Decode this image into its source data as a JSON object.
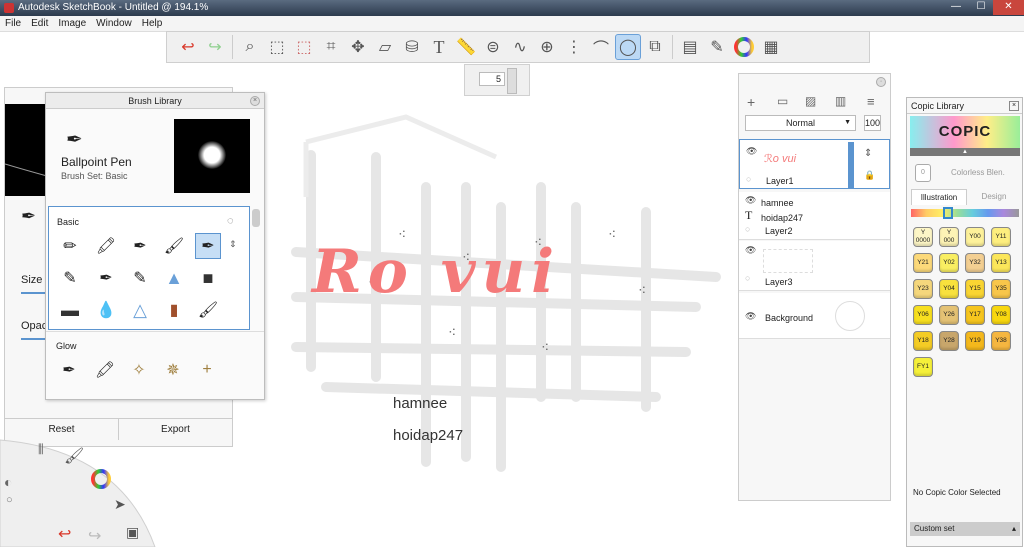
{
  "window": {
    "title": "Autodesk SketchBook - Untitled @ 194.1%",
    "minimize": "—",
    "maximize": "☐",
    "close": "✕"
  },
  "menu": [
    "File",
    "Edit",
    "Image",
    "Window",
    "Help"
  ],
  "toolbar": {
    "icons": [
      "undo-icon",
      "redo-icon",
      "zoom-icon",
      "select-rect-icon",
      "select-lasso-icon",
      "crop-icon",
      "transform-icon",
      "distort-icon",
      "cylinder-icon",
      "text-icon",
      "ruler-icon",
      "ellipse-guide-icon",
      "french-curve-icon",
      "perspective-icon",
      "symmetry-icon",
      "stroke-icon",
      "ellipse-icon",
      "shapes-icon",
      "copic-icon",
      "brushes-icon",
      "color-wheel-icon",
      "palette-icon"
    ],
    "brush_size": "5"
  },
  "left_panel": {
    "size_label": "Size",
    "opacity_label": "Opacit",
    "reset_label": "Reset",
    "export_label": "Export"
  },
  "brush_library": {
    "title": "Brush Library",
    "brush_name": "Ballpoint Pen",
    "brush_set": "Brush Set: Basic",
    "basic_label": "Basic",
    "glow_label": "Glow"
  },
  "canvas": {
    "lettering": "Ro vui",
    "text1": "hamnee",
    "text2": "hoidap247"
  },
  "layers": {
    "blend_mode": "Normal",
    "opacity": "100",
    "rows": [
      {
        "name": "Layer1"
      },
      {
        "name": "hamnee",
        "sub1": "hoidap247",
        "sub2": "Layer2"
      },
      {
        "name": "Layer3"
      },
      {
        "name": "Background"
      }
    ]
  },
  "copic": {
    "title": "Copic Library",
    "logo": "COPIC",
    "colorless": "Colorless Blen.",
    "colorless_code": "0",
    "tab_illustration": "Illustration",
    "tab_design": "Design",
    "swatches": [
      {
        "code": "Y\n0000",
        "color": "#fdf6c6"
      },
      {
        "code": "Y\n000",
        "color": "#fdf3b5"
      },
      {
        "code": "Y00",
        "color": "#fdf19a"
      },
      {
        "code": "Y11",
        "color": "#fdee7e"
      },
      {
        "code": "Y21",
        "color": "#fcd97a"
      },
      {
        "code": "Y02",
        "color": "#f9ee62"
      },
      {
        "code": "Y32",
        "color": "#f3cf92"
      },
      {
        "code": "Y13",
        "color": "#fbe65a"
      },
      {
        "code": "Y23",
        "color": "#f5d77c"
      },
      {
        "code": "Y04",
        "color": "#f8e13d"
      },
      {
        "code": "Y15",
        "color": "#f9d532"
      },
      {
        "code": "Y35",
        "color": "#f8c64a"
      },
      {
        "code": "Y06",
        "color": "#f7df1f"
      },
      {
        "code": "Y26",
        "color": "#e4c274"
      },
      {
        "code": "Y17",
        "color": "#f6c51e"
      },
      {
        "code": "Y08",
        "color": "#f8d70f"
      },
      {
        "code": "Y18",
        "color": "#f4cc25"
      },
      {
        "code": "Y28",
        "color": "#c8a66b"
      },
      {
        "code": "Y19",
        "color": "#f4b81c"
      },
      {
        "code": "Y38",
        "color": "#f5b640"
      },
      {
        "code": "FY1",
        "color": "#f5f03a"
      }
    ],
    "status": "No Copic Color Selected",
    "custom_set": "Custom set"
  },
  "colors": {
    "accent": "#5b94cf",
    "lettering": "#f47a7a"
  }
}
